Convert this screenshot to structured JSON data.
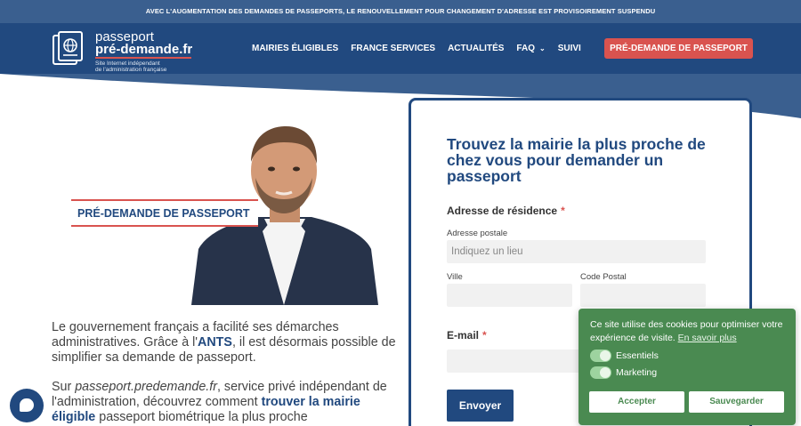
{
  "topbar": {
    "text": "AVEC L'AUGMENTATION DES DEMANDES DE PASSEPORTS, LE RENOUVELLEMENT POUR CHANGEMENT D'ADRESSE EST PROVISOIREMENT SUSPENDU"
  },
  "logo": {
    "line1": "passeport",
    "line2": "pré-demande.fr",
    "line3": "Site Internet indépendant",
    "line4": "de l'administration française"
  },
  "nav": {
    "items": [
      {
        "label": "MAIRIES ÉLIGIBLES"
      },
      {
        "label": "FRANCE SERVICES"
      },
      {
        "label": "ACTUALITÉS"
      },
      {
        "label": "FAQ"
      },
      {
        "label": "SUIVI"
      }
    ],
    "cta": "PRÉ-DEMANDE DE PASSEPORT"
  },
  "hero": {
    "badge": "PRÉ-DEMANDE DE PASSEPORT"
  },
  "intro": {
    "p1_a": "Le gouvernement français a facilité ses démarches administratives. Grâce à l'",
    "p1_bold": "ANTS",
    "p1_b": ", il est désormais possible de simplifier sa demande de passeport.",
    "p2_a": "Sur ",
    "p2_italic": "passeport.predemande.fr",
    "p2_b": ", service privé indépendant de l'administration, découvrez comment ",
    "p2_bold": "trouver la mairie éligible",
    "p2_c": " passeport biométrique la plus proche"
  },
  "form": {
    "title": "Trouvez la mairie la plus proche de chez vous pour demander un passeport",
    "address_section": "Adresse de résidence",
    "required_mark": "*",
    "postal_label": "Adresse postale",
    "postal_placeholder": "Indiquez un lieu",
    "city_label": "Ville",
    "zip_label": "Code Postal",
    "email_section": "E-mail",
    "submit": "Envoyer"
  },
  "cookie": {
    "text": "Ce site utilise des cookies pour optimiser votre expérience de visite.",
    "link": "En savoir plus",
    "toggle1": "Essentiels",
    "toggle2": "Marketing",
    "accept": "Accepter",
    "save": "Sauvegarder"
  },
  "colors": {
    "navy": "#21497f",
    "red": "#d9534f",
    "cookie_green": "#4a8a51"
  }
}
